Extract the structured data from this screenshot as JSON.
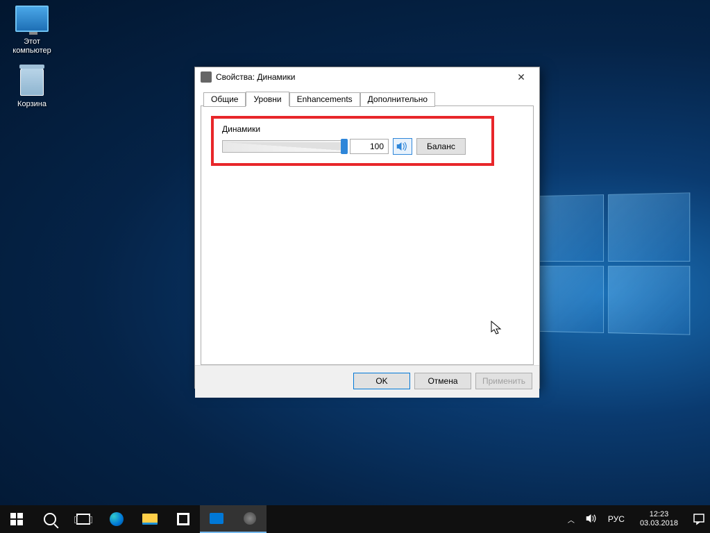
{
  "desktop": {
    "icons": [
      {
        "label": "Этот компьютер"
      },
      {
        "label": "Корзина"
      }
    ]
  },
  "dialog": {
    "title": "Свойства: Динамики",
    "tabs": {
      "general": "Общие",
      "levels": "Уровни",
      "enhancements": "Enhancements",
      "advanced": "Дополнительно"
    },
    "levels": {
      "group_label": "Динамики",
      "value": "100",
      "balance_btn": "Баланс"
    },
    "buttons": {
      "ok": "OK",
      "cancel": "Отмена",
      "apply": "Применить"
    }
  },
  "taskbar": {
    "tray": {
      "language": "РУС",
      "time": "12:23",
      "date": "03.03.2018"
    }
  }
}
